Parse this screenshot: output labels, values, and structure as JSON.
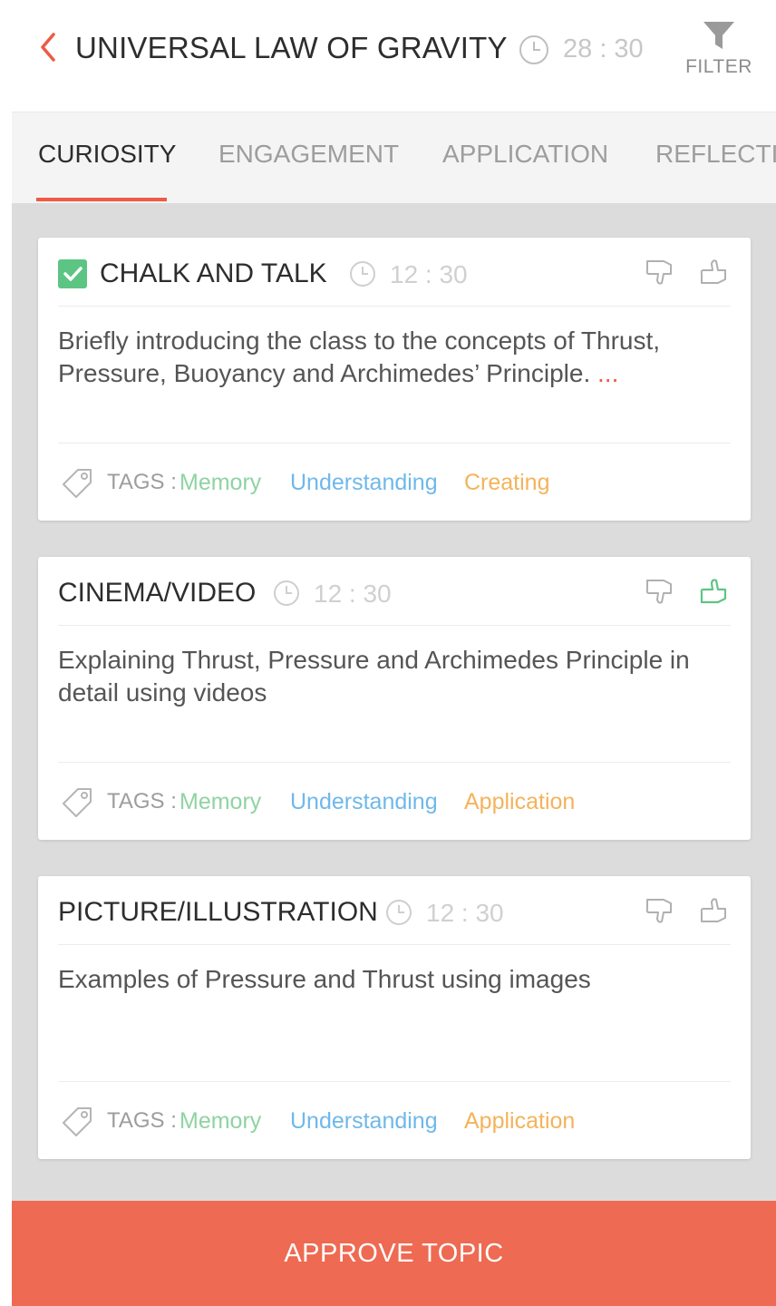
{
  "header": {
    "title": "UNIVERSAL LAW OF GRAVITY",
    "time": "28 : 30",
    "filter_label": "FILTER"
  },
  "tabs": [
    {
      "label": "CURIOSITY",
      "active": true
    },
    {
      "label": "ENGAGEMENT",
      "active": false
    },
    {
      "label": "APPLICATION",
      "active": false
    },
    {
      "label": "REFLECTION",
      "active": false
    }
  ],
  "cards": [
    {
      "title": "CHALK AND TALK",
      "checked": true,
      "time": "12 : 30",
      "description": "Briefly introducing the class to the concepts of Thrust, Pressure, Buoyancy and Archimedes’ Principle.",
      "more": "...",
      "liked": false,
      "tags_label": "TAGS :",
      "tags": [
        "Memory",
        "Understanding",
        "Creating"
      ]
    },
    {
      "title": "CINEMA/VIDEO",
      "checked": false,
      "time": "12 : 30",
      "description": "Explaining Thrust, Pressure and Archimedes Principle in detail using videos",
      "more": "",
      "liked": true,
      "tags_label": "TAGS :",
      "tags": [
        "Memory",
        "Understanding",
        "Application"
      ]
    },
    {
      "title": "PICTURE/ILLUSTRATION",
      "checked": false,
      "time": "12 : 30",
      "description": "Examples of Pressure and Thrust using images",
      "more": "",
      "liked": false,
      "tags_label": "TAGS :",
      "tags": [
        "Memory",
        "Understanding",
        "Application"
      ]
    }
  ],
  "footer": {
    "approve_label": "APPROVE TOPIC"
  },
  "colors": {
    "accent": "#ee5a44",
    "check_green": "#5cc584",
    "tag_memory": "#8fd3a2",
    "tag_understanding": "#6fb8ea",
    "tag_other": "#f4b35a"
  },
  "icons": {
    "back": "chevron-left-icon",
    "clock": "clock-icon",
    "filter": "filter-funnel-icon",
    "dislike": "thumbs-down-icon",
    "like": "thumbs-up-icon",
    "tag": "tag-icon",
    "check": "checkbox-checked-icon"
  }
}
